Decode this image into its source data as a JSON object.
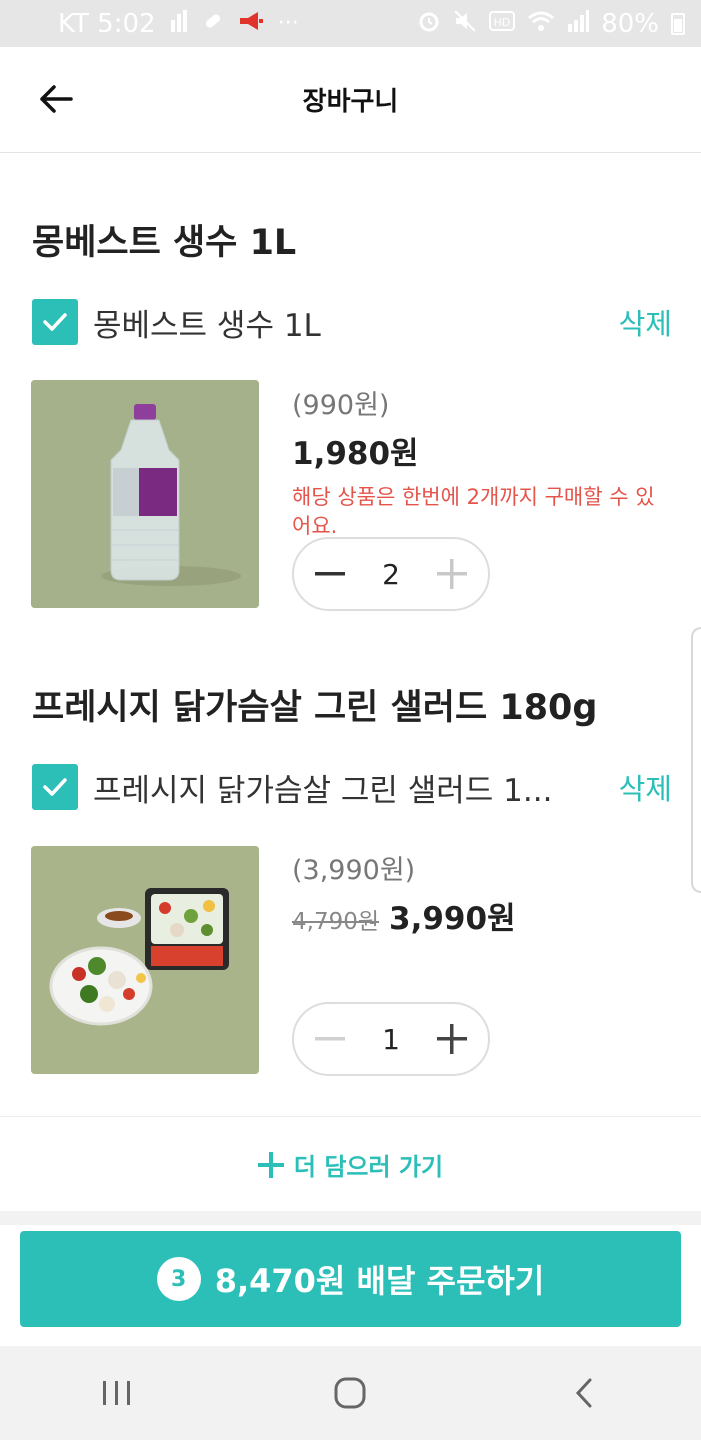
{
  "status_bar": {
    "carrier_time": "KT 5:02",
    "battery": "80%"
  },
  "header": {
    "title": "장바구니"
  },
  "cart": {
    "items": [
      {
        "section_title": "몽베스트 생수 1L",
        "checkbox_label": "몽베스트 생수 1L",
        "delete_label": "삭제",
        "unit_price": "(990원)",
        "original_price": "",
        "total_price": "1,980원",
        "limit_note": "해당 상품은 한번에 2개까지 구매할 수 있어요.",
        "quantity": "2",
        "checked": true
      },
      {
        "section_title": "프레시지 닭가슴살 그린 샐러드 180g",
        "checkbox_label": "프레시지 닭가슴살 그린 샐러드 1...",
        "delete_label": "삭제",
        "unit_price": "(3,990원)",
        "original_price": "4,790원",
        "total_price": "3,990원",
        "limit_note": "",
        "quantity": "1",
        "checked": true
      }
    ]
  },
  "more_button": {
    "label": "더 담으러 가기"
  },
  "order_button": {
    "count": "3",
    "label": "8,470원 배달 주문하기"
  },
  "colors": {
    "accent": "#2bbfb8",
    "warning": "#e5544b"
  }
}
